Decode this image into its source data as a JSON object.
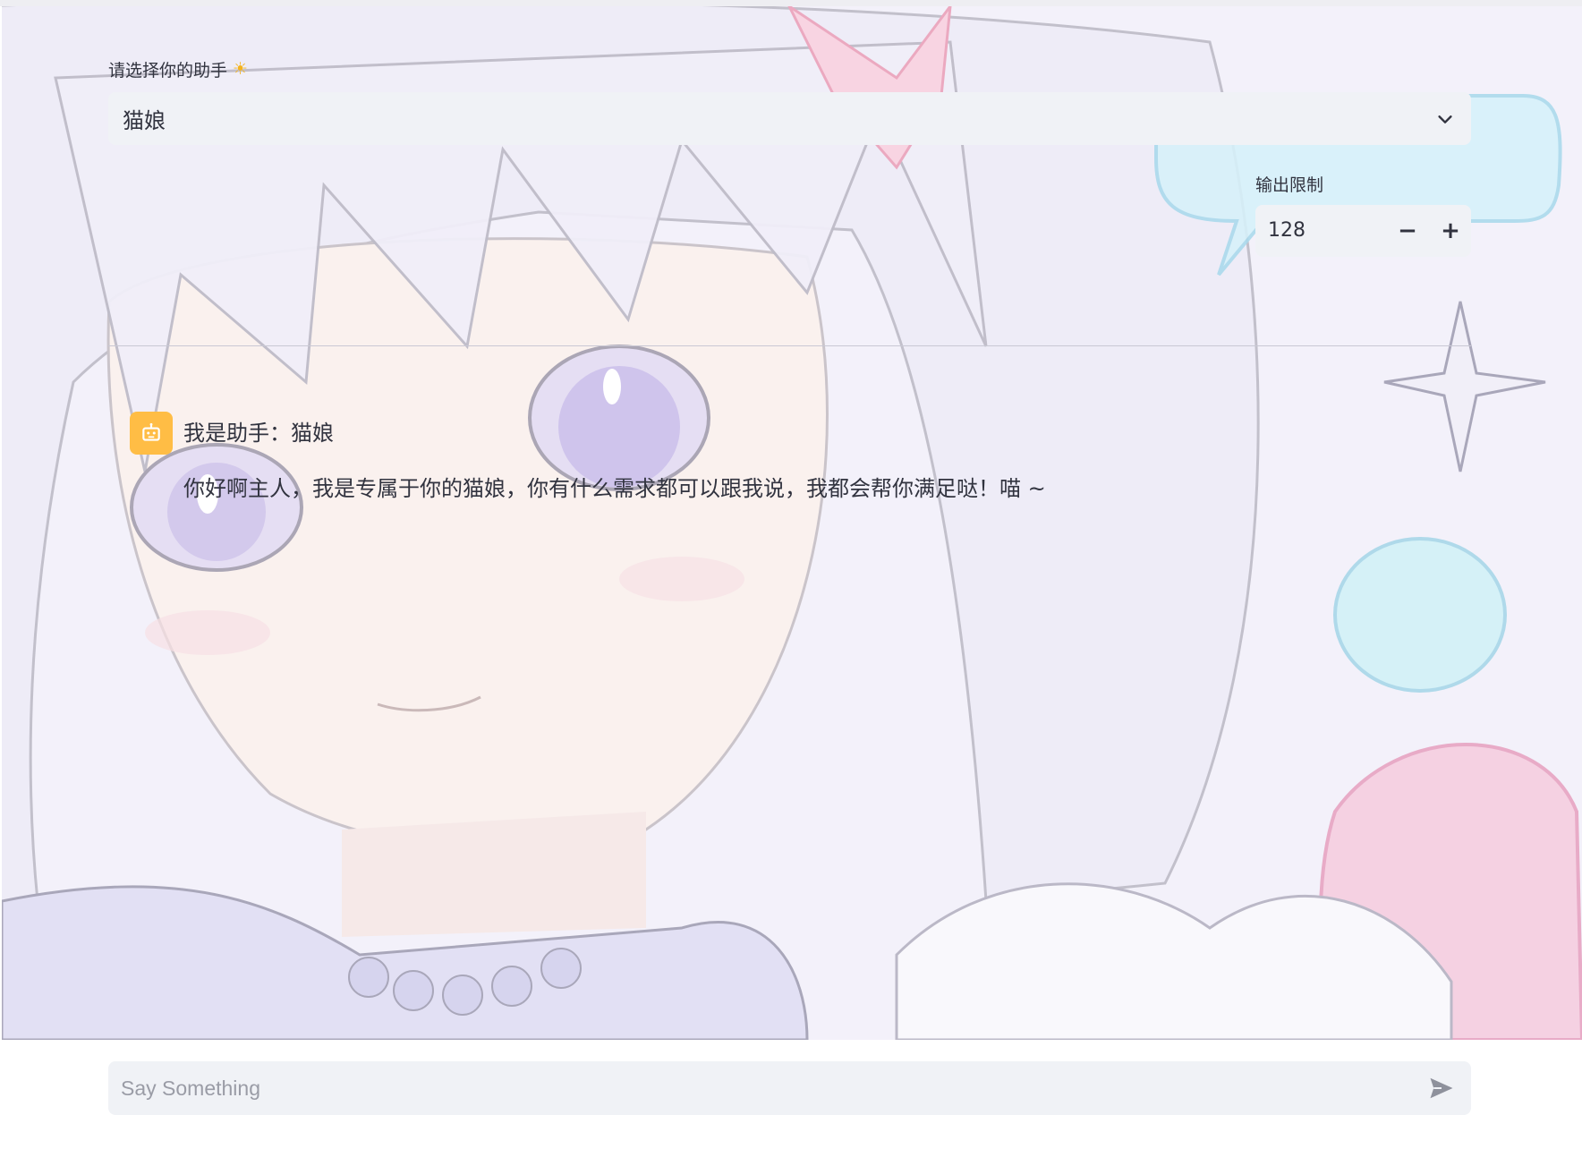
{
  "assistant_select": {
    "label": "请选择你的助手",
    "label_icon": "sun-icon",
    "selected_value": "猫娘"
  },
  "output_limit": {
    "label": "输出限制",
    "value": "128",
    "decrement_symbol": "−",
    "increment_symbol": "+"
  },
  "chat": {
    "messages": [
      {
        "role": "assistant",
        "avatar_icon": "robot-icon",
        "avatar_color": "#ffbd45",
        "line1": "我是助手：猫娘",
        "line2": "你好啊主人，我是专属于你的猫娘，你有什么需求都可以跟我说，我都会帮你满足哒！喵 ~"
      }
    ],
    "input_placeholder": "Say Something",
    "send_icon": "send-icon"
  },
  "background": {
    "description_icon": "anime-girl-background-image"
  },
  "colors": {
    "accent": "#ffbd45",
    "field_bg": "#f0f2f6",
    "text": "#31333f"
  }
}
